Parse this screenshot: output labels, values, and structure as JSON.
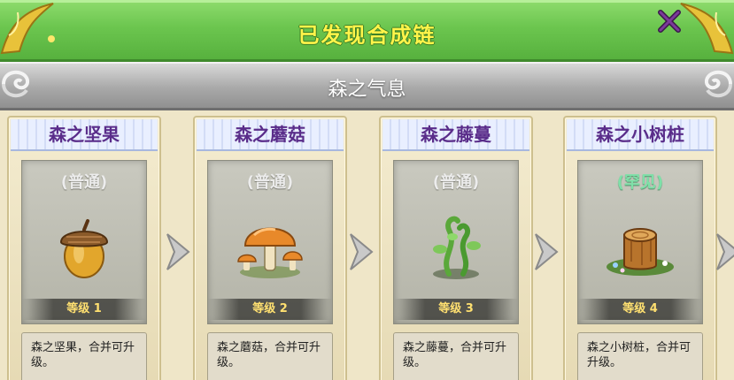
{
  "header": {
    "title": "已发现合成链"
  },
  "category": {
    "title": "森之气息"
  },
  "icons": {
    "close": "close-x-icon",
    "arrow": "chevron-right-icon",
    "corner": "golden-flourish-icon",
    "scroll": "scroll-ornament-icon"
  },
  "colors": {
    "header_green": "#6cc64f",
    "title_yellow": "#fff44a",
    "card_title_purple": "#5a2d8a",
    "rare_green": "#7ee0a8"
  },
  "items": [
    {
      "name": "森之坚果",
      "rarity": "(普通)",
      "rarity_type": "common",
      "level": "等级 1",
      "desc": "森之坚果，合并可升级。",
      "art": "acorn-icon"
    },
    {
      "name": "森之蘑菇",
      "rarity": "(普通)",
      "rarity_type": "common",
      "level": "等级 2",
      "desc": "森之蘑菇，合并可升级。",
      "art": "mushroom-icon"
    },
    {
      "name": "森之藤蔓",
      "rarity": "(普通)",
      "rarity_type": "common",
      "level": "等级 3",
      "desc": "森之藤蔓，合并可升级。",
      "art": "vine-icon"
    },
    {
      "name": "森之小树桩",
      "rarity": "(罕见)",
      "rarity_type": "rare",
      "level": "等级 4",
      "desc": "森之小树桩，合并可升级。",
      "art": "tree-stump-icon"
    }
  ]
}
